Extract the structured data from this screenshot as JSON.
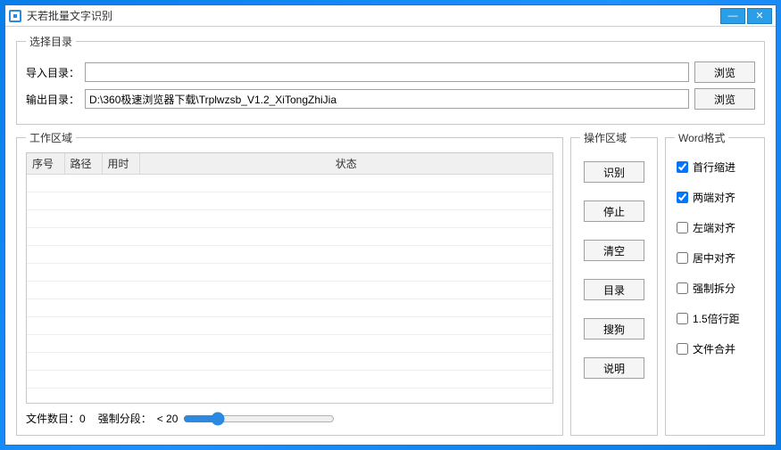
{
  "window": {
    "title": "天若批量文字识别",
    "min_label": "—",
    "close_label": "✕"
  },
  "dir_group": {
    "legend": "选择目录",
    "import_label": "导入目录：",
    "import_value": "",
    "output_label": "输出目录：",
    "output_value": "D:\\360极速浏览器下载\\Trplwzsb_V1.2_XiTongZhiJia",
    "browse_label": "浏览"
  },
  "work": {
    "legend": "工作区域",
    "cols": {
      "seq": "序号",
      "path": "路径",
      "time": "用时",
      "status": "状态"
    },
    "footer": {
      "file_count_label": "文件数目：",
      "file_count_value": "0",
      "force_seg_label": "强制分段：",
      "force_seg_value": "< 20"
    }
  },
  "ops": {
    "legend": "操作区域",
    "buttons": {
      "recognize": "识别",
      "stop": "停止",
      "clear": "清空",
      "dir": "目录",
      "sogou": "搜狗",
      "help": "说明"
    }
  },
  "wordfmt": {
    "legend": "Word格式",
    "items": {
      "first_indent": "首行缩进",
      "justify": "两端对齐",
      "left": "左端对齐",
      "center": "居中对齐",
      "force_split": "强制拆分",
      "line_15": "1.5倍行距",
      "merge_files": "文件合并"
    },
    "checked": {
      "first_indent": true,
      "justify": true,
      "left": false,
      "center": false,
      "force_split": false,
      "line_15": false,
      "merge_files": false
    }
  }
}
